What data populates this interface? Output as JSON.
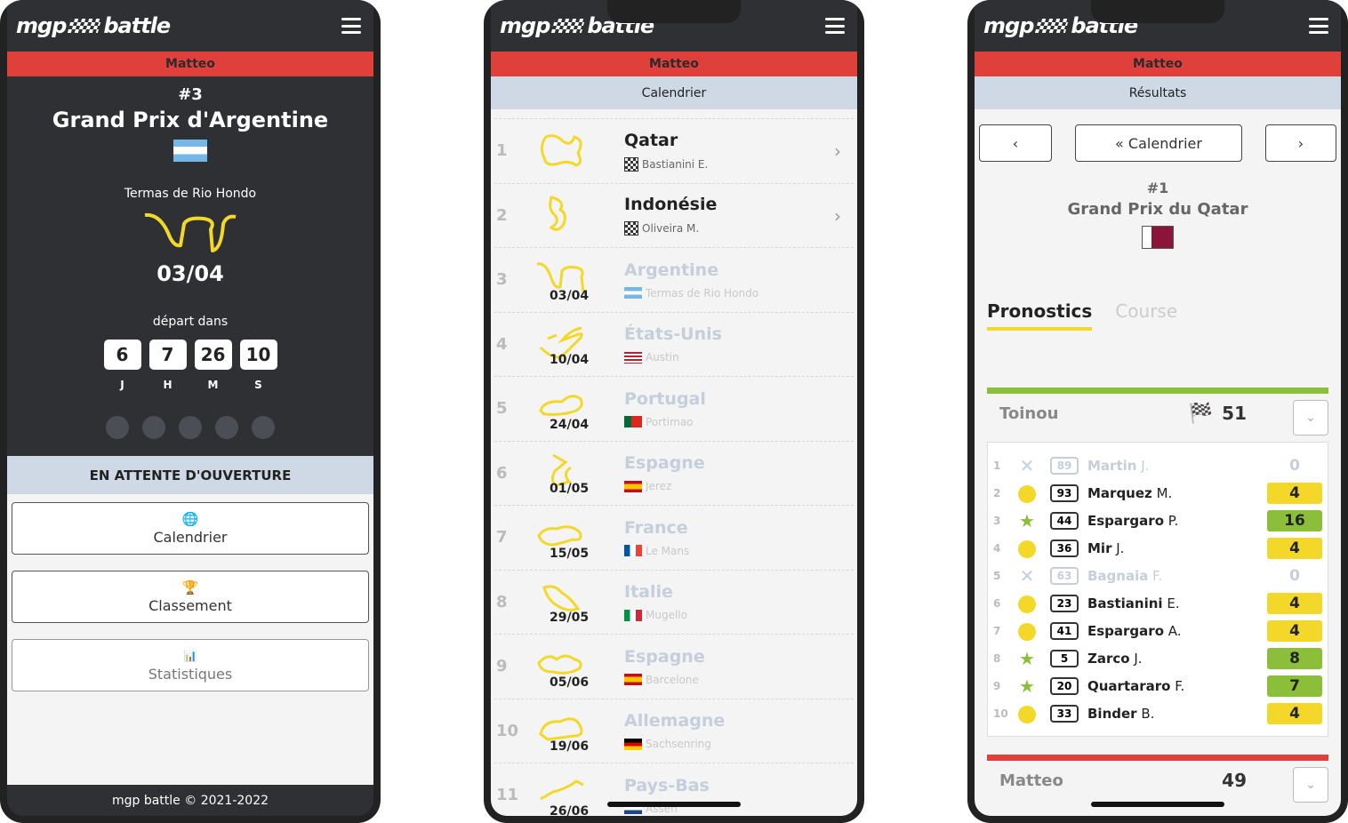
{
  "brand": "mgp battle",
  "user": "Matteo",
  "phone1": {
    "gp_number": "#3",
    "gp_name": "Grand Prix d'Argentine",
    "circuit": "Termas de Rio Hondo",
    "date": "03/04",
    "depart_label": "départ dans",
    "countdown": [
      {
        "value": "6",
        "unit": "J"
      },
      {
        "value": "7",
        "unit": "H"
      },
      {
        "value": "26",
        "unit": "M"
      },
      {
        "value": "10",
        "unit": "S"
      }
    ],
    "status": "EN ATTENTE D'OUVERTURE",
    "menu": [
      {
        "label": "Calendrier",
        "icon": "globe-icon"
      },
      {
        "label": "Classement",
        "icon": "trophy-icon"
      },
      {
        "label": "Statistiques",
        "icon": "bar-chart-icon"
      }
    ],
    "footer": "mgp battle © 2021-2022"
  },
  "phone2": {
    "title": "Calendrier",
    "races": [
      {
        "num": "1",
        "country": "Qatar",
        "winner": "Bastianini E.",
        "state": "past"
      },
      {
        "num": "2",
        "country": "Indonésie",
        "winner": "Oliveira M.",
        "state": "past"
      },
      {
        "num": "3",
        "country": "Argentine",
        "date": "03/04",
        "circuit": "Termas de Rio Hondo",
        "flag": "ar",
        "state": "future"
      },
      {
        "num": "4",
        "country": "États-Unis",
        "date": "10/04",
        "circuit": "Austin",
        "flag": "us",
        "state": "future"
      },
      {
        "num": "5",
        "country": "Portugal",
        "date": "24/04",
        "circuit": "Portimao",
        "flag": "pt",
        "state": "future"
      },
      {
        "num": "6",
        "country": "Espagne",
        "date": "01/05",
        "circuit": "Jerez",
        "flag": "es",
        "state": "future"
      },
      {
        "num": "7",
        "country": "France",
        "date": "15/05",
        "circuit": "Le Mans",
        "flag": "fr",
        "state": "future"
      },
      {
        "num": "8",
        "country": "Italie",
        "date": "29/05",
        "circuit": "Mugello",
        "flag": "it",
        "state": "future"
      },
      {
        "num": "9",
        "country": "Espagne",
        "date": "05/06",
        "circuit": "Barcelone",
        "flag": "es",
        "state": "future"
      },
      {
        "num": "10",
        "country": "Allemagne",
        "date": "19/06",
        "circuit": "Sachsenring",
        "flag": "de",
        "state": "future"
      },
      {
        "num": "11",
        "country": "Pays-Bas",
        "date": "26/06",
        "circuit": "Assen",
        "flag": "nl",
        "state": "future"
      }
    ]
  },
  "phone3": {
    "title": "Résultats",
    "nav_center": "« Calendrier",
    "gp_number": "#1",
    "gp_name": "Grand Prix du Qatar",
    "tabs": [
      "Pronostics",
      "Course"
    ],
    "player1": {
      "name": "Toinou",
      "score": "51"
    },
    "results": [
      {
        "pos": "1",
        "mark": "x",
        "bib": "89",
        "name": "Martin",
        "init": "J.",
        "pts": "0",
        "color": "none"
      },
      {
        "pos": "2",
        "mark": "dot",
        "bib": "93",
        "name": "Marquez",
        "init": "M.",
        "pts": "4",
        "color": "#f3d82a"
      },
      {
        "pos": "3",
        "mark": "star",
        "bib": "44",
        "name": "Espargaro",
        "init": "P.",
        "pts": "16",
        "color": "#8bbf3a"
      },
      {
        "pos": "4",
        "mark": "dot",
        "bib": "36",
        "name": "Mir",
        "init": "J.",
        "pts": "4",
        "color": "#f3d82a"
      },
      {
        "pos": "5",
        "mark": "x",
        "bib": "63",
        "name": "Bagnaia",
        "init": "F.",
        "pts": "0",
        "color": "none"
      },
      {
        "pos": "6",
        "mark": "dot",
        "bib": "23",
        "name": "Bastianini",
        "init": "E.",
        "pts": "4",
        "color": "#f3d82a"
      },
      {
        "pos": "7",
        "mark": "dot",
        "bib": "41",
        "name": "Espargaro",
        "init": "A.",
        "pts": "4",
        "color": "#f3d82a"
      },
      {
        "pos": "8",
        "mark": "star",
        "bib": "5",
        "name": "Zarco",
        "init": "J.",
        "pts": "8",
        "color": "#8bbf3a"
      },
      {
        "pos": "9",
        "mark": "star",
        "bib": "20",
        "name": "Quartararo",
        "init": "F.",
        "pts": "7",
        "color": "#8bbf3a"
      },
      {
        "pos": "10",
        "mark": "dot",
        "bib": "33",
        "name": "Binder",
        "init": "B.",
        "pts": "4",
        "color": "#f3d82a"
      }
    ],
    "player2": {
      "name": "Matteo",
      "score": "49"
    }
  }
}
